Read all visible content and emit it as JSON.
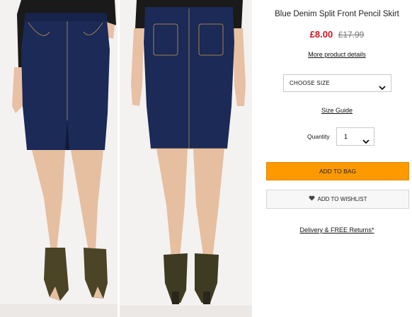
{
  "product": {
    "title": "Blue Denim Split Front Pencil Skirt",
    "price_now": "£8.00",
    "price_was": "£17.99",
    "more_details_label": "More product details"
  },
  "size": {
    "selected": "CHOOSE SIZE"
  },
  "size_guide_label": "Size Guide",
  "quantity": {
    "label": "Quantity",
    "value": "1"
  },
  "actions": {
    "add_to_bag": "ADD TO BAG",
    "add_to_wishlist": "ADD TO WISHLIST"
  },
  "delivery_label": "Delivery & FREE Returns*",
  "colors": {
    "price": "#d3131f",
    "bag_button": "#ff9900",
    "denim": "#1b2a56"
  },
  "icons": {
    "select": "chevron-down-icon",
    "wishlist": "heart-icon"
  }
}
